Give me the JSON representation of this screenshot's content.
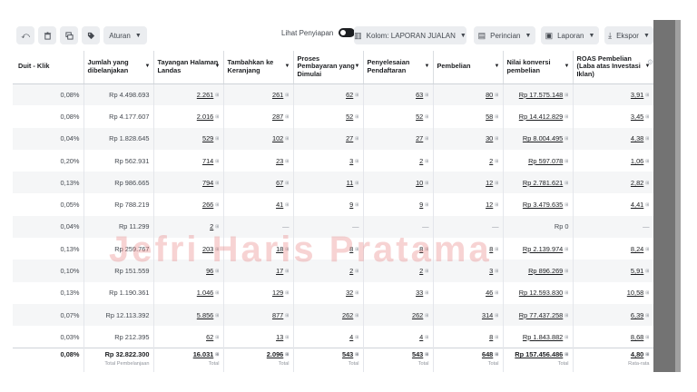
{
  "toolbar": {
    "icons": [
      "undo-icon",
      "trash-icon",
      "duplicate-icon",
      "tag-icon"
    ],
    "aturan_label": "Aturan",
    "lihat_penyiapan_label": "Lihat Penyiapan",
    "kolom_label": "Kolom: LAPORAN JUALAN",
    "perincian_label": "Perincian",
    "laporan_label": "Laporan",
    "ekspor_label": "Ekspor"
  },
  "headers": [
    "Duit - Klik",
    "Jumlah yang dibelanjakan",
    "Tayangan Halaman Landas",
    "Tambahkan ke Keranjang",
    "Proses Pembayaran yang Dimulai",
    "Penyelesaian Pendaftaran",
    "Pembelian",
    "Nilai konversi pembelian",
    "ROAS Pembelian (Laba atas Investasi Iklan)"
  ],
  "rows": [
    [
      "0,08%",
      "Rp 4.498.693",
      "2.261",
      "261",
      "62",
      "63",
      "80",
      "Rp 17.575.148",
      "3,91"
    ],
    [
      "0,08%",
      "Rp 4.177.607",
      "2.016",
      "287",
      "52",
      "52",
      "58",
      "Rp 14.412.829",
      "3,45"
    ],
    [
      "0,04%",
      "Rp 1.828.645",
      "529",
      "102",
      "27",
      "27",
      "30",
      "Rp 8.004.495",
      "4,38"
    ],
    [
      "0,20%",
      "Rp 562.931",
      "714",
      "23",
      "3",
      "2",
      "2",
      "Rp 597.078",
      "1,06"
    ],
    [
      "0,13%",
      "Rp 986.665",
      "794",
      "67",
      "11",
      "10",
      "12",
      "Rp 2.781.621",
      "2,82"
    ],
    [
      "0,05%",
      "Rp 788.219",
      "266",
      "41",
      "9",
      "9",
      "12",
      "Rp 3.479.635",
      "4,41"
    ],
    [
      "0,04%",
      "Rp 11.299",
      "2",
      "—",
      "—",
      "—",
      "—",
      "Rp 0",
      "—"
    ],
    [
      "0,13%",
      "Rp 259.767",
      "203",
      "18",
      "8",
      "8",
      "8",
      "Rp 2.139.974",
      "8,24"
    ],
    [
      "0,10%",
      "Rp 151.559",
      "96",
      "17",
      "2",
      "2",
      "3",
      "Rp 896.269",
      "5,91"
    ],
    [
      "0,13%",
      "Rp 1.190.361",
      "1.046",
      "129",
      "32",
      "33",
      "46",
      "Rp 12.593.830",
      "10,58"
    ],
    [
      "0,07%",
      "Rp 12.113.392",
      "5.856",
      "877",
      "262",
      "262",
      "314",
      "Rp 77.437.258",
      "6,39"
    ],
    [
      "0,03%",
      "Rp 212.395",
      "62",
      "13",
      "4",
      "4",
      "8",
      "Rp 1.843.882",
      "8,68"
    ]
  ],
  "totals": {
    "values": [
      "0,08%",
      "Rp 32.822.300",
      "16.031",
      "2.096",
      "543",
      "543",
      "648",
      "Rp 157.456.486",
      "4,80"
    ],
    "labels": [
      "",
      "Total Pembelanjaan",
      "Total",
      "Total",
      "Total",
      "Total",
      "Total",
      "Total",
      "Rata-rata"
    ]
  },
  "watermark_text": "Jefri Haris Pratama"
}
